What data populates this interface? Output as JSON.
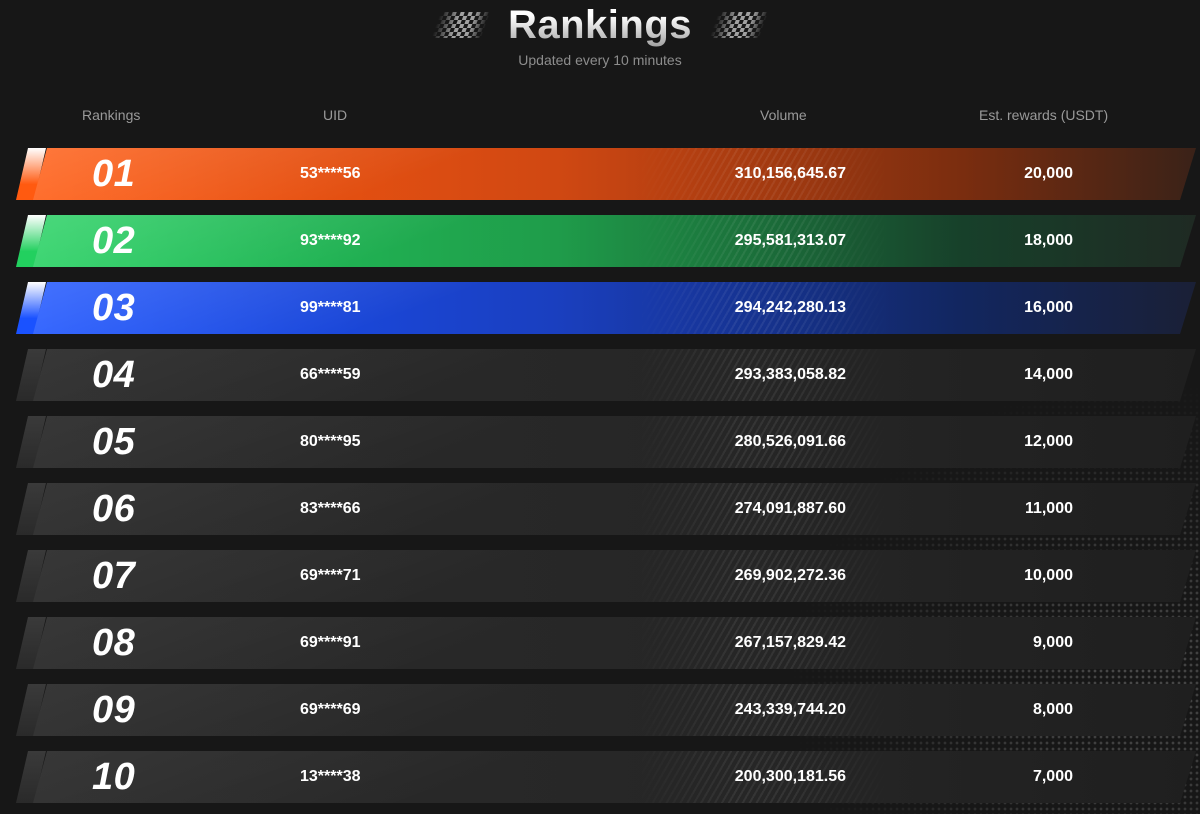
{
  "header": {
    "title": "Rankings",
    "subtitle": "Updated every 10 minutes"
  },
  "columns": {
    "rank": "Rankings",
    "uid": "UID",
    "volume": "Volume",
    "rewards": "Est. rewards (USDT)"
  },
  "colors": {
    "gold_start": "#ff5a10",
    "gold_end": "#7a2d0f",
    "green_start": "#22d05f",
    "green_end": "#17402a",
    "blue_start": "#1a52ff",
    "blue_end": "#12265f",
    "gray": "#2a2a2a"
  },
  "rows": [
    {
      "rank": "01",
      "uid": "53****56",
      "volume": "310,156,645.67",
      "reward": "20,000",
      "tier": "orange"
    },
    {
      "rank": "02",
      "uid": "93****92",
      "volume": "295,581,313.07",
      "reward": "18,000",
      "tier": "green"
    },
    {
      "rank": "03",
      "uid": "99****81",
      "volume": "294,242,280.13",
      "reward": "16,000",
      "tier": "blue"
    },
    {
      "rank": "04",
      "uid": "66****59",
      "volume": "293,383,058.82",
      "reward": "14,000",
      "tier": "gray"
    },
    {
      "rank": "05",
      "uid": "80****95",
      "volume": "280,526,091.66",
      "reward": "12,000",
      "tier": "gray"
    },
    {
      "rank": "06",
      "uid": "83****66",
      "volume": "274,091,887.60",
      "reward": "11,000",
      "tier": "gray"
    },
    {
      "rank": "07",
      "uid": "69****71",
      "volume": "269,902,272.36",
      "reward": "10,000",
      "tier": "gray"
    },
    {
      "rank": "08",
      "uid": "69****91",
      "volume": "267,157,829.42",
      "reward": "9,000",
      "tier": "gray"
    },
    {
      "rank": "09",
      "uid": "69****69",
      "volume": "243,339,744.20",
      "reward": "8,000",
      "tier": "gray"
    },
    {
      "rank": "10",
      "uid": "13****38",
      "volume": "200,300,181.56",
      "reward": "7,000",
      "tier": "gray"
    }
  ]
}
